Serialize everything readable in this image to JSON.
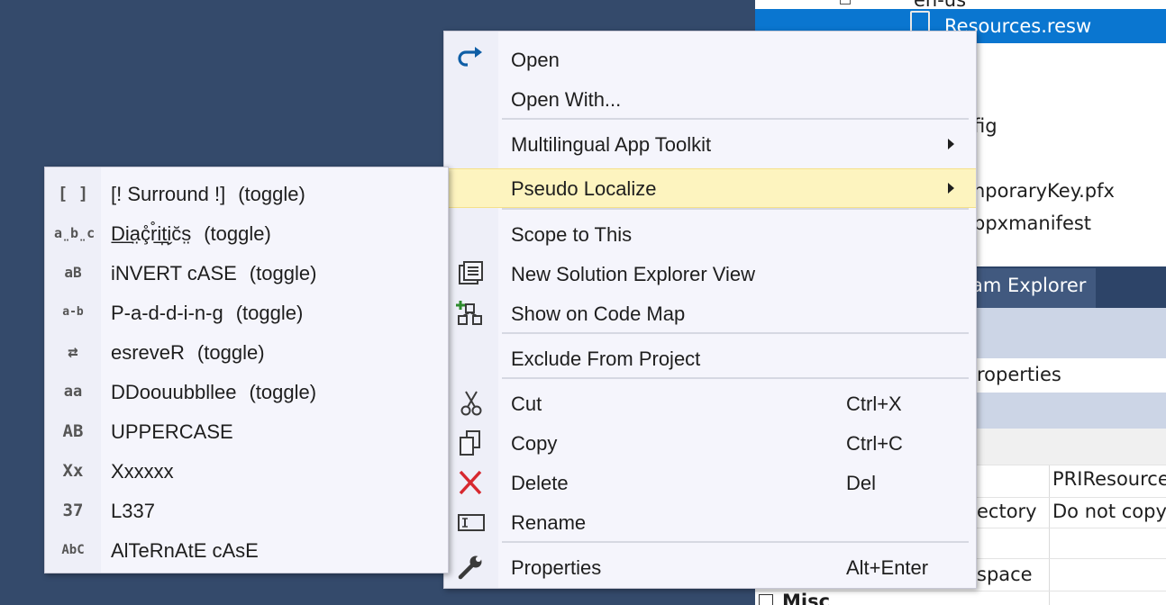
{
  "background_panel": {
    "tree_items": [
      "en-us",
      "Resources.resw",
      "fig",
      "nporaryKey.pfx",
      "ppxmanifest"
    ],
    "tab_label": "am Explorer",
    "properties_title": "roperties",
    "property_rows": [
      {
        "name": "",
        "value": "PRIResource"
      },
      {
        "name": "ectory",
        "value": "Do not copy"
      },
      {
        "name": "",
        "value": ""
      },
      {
        "name": "space",
        "value": ""
      }
    ],
    "misc_label": "Misc"
  },
  "main_menu": {
    "items": [
      {
        "label": "Open",
        "icon": "open-redo-arrow-icon"
      },
      {
        "label": "Open With..."
      },
      {
        "label": "Multilingual App Toolkit",
        "has_submenu": true
      },
      {
        "label": "Pseudo Localize",
        "has_submenu": true,
        "highlighted": true
      },
      {
        "label": "Scope to This"
      },
      {
        "label": "New Solution Explorer View",
        "icon": "new-view-icon"
      },
      {
        "label": "Show on Code Map",
        "icon": "code-map-icon"
      },
      {
        "label": "Exclude From Project"
      },
      {
        "label": "Cut",
        "shortcut": "Ctrl+X",
        "icon": "scissors-icon"
      },
      {
        "label": "Copy",
        "shortcut": "Ctrl+C",
        "icon": "copy-icon"
      },
      {
        "label": "Delete",
        "shortcut": "Del",
        "icon": "delete-x-icon"
      },
      {
        "label": "Rename",
        "icon": "rename-icon"
      },
      {
        "label": "Properties",
        "shortcut": "Alt+Enter",
        "icon": "wrench-icon"
      }
    ]
  },
  "sub_menu": {
    "toggle_text": "(toggle)",
    "items": [
      {
        "label": "[! Surround !]",
        "toggle": true,
        "icon_glyph": "[ ]",
        "icon": "surround-icon"
      },
      {
        "label": "D̲i̲a̤ç̊r̊i̲t̪i̬c̆s̤",
        "toggle": true,
        "icon_glyph": "a̤b̤c",
        "icon": "diacritics-icon"
      },
      {
        "label": "iNVERT cASE",
        "toggle": true,
        "icon_glyph": "aB",
        "icon": "invert-case-icon"
      },
      {
        "label": "P-a-d-d-i-n-g",
        "toggle": true,
        "icon_glyph": "a-b",
        "icon": "padding-icon"
      },
      {
        "label": "esreveR",
        "toggle": true,
        "icon_glyph": "⇄",
        "icon": "reverse-icon"
      },
      {
        "label": "DDoouubbllee",
        "toggle": true,
        "icon_glyph": "aa",
        "icon": "double-icon"
      },
      {
        "label": "UPPERCASE",
        "icon_glyph": "AB",
        "icon": "uppercase-icon"
      },
      {
        "label": "Xxxxxx",
        "icon_glyph": "Xx",
        "icon": "capitalize-icon"
      },
      {
        "label": "L337",
        "icon_glyph": "37",
        "icon": "leet-icon"
      },
      {
        "label": "AlTeRnAtE cAsE",
        "icon_glyph": "AbC",
        "icon": "alternate-case-icon"
      }
    ]
  },
  "colors": {
    "desktop": "#344a6b",
    "selection": "#0a76d0",
    "menu_bg": "#f5f5fc",
    "highlight": "#fdf4bf",
    "delete_red": "#d7282f",
    "open_blue": "#0e5ea6"
  }
}
